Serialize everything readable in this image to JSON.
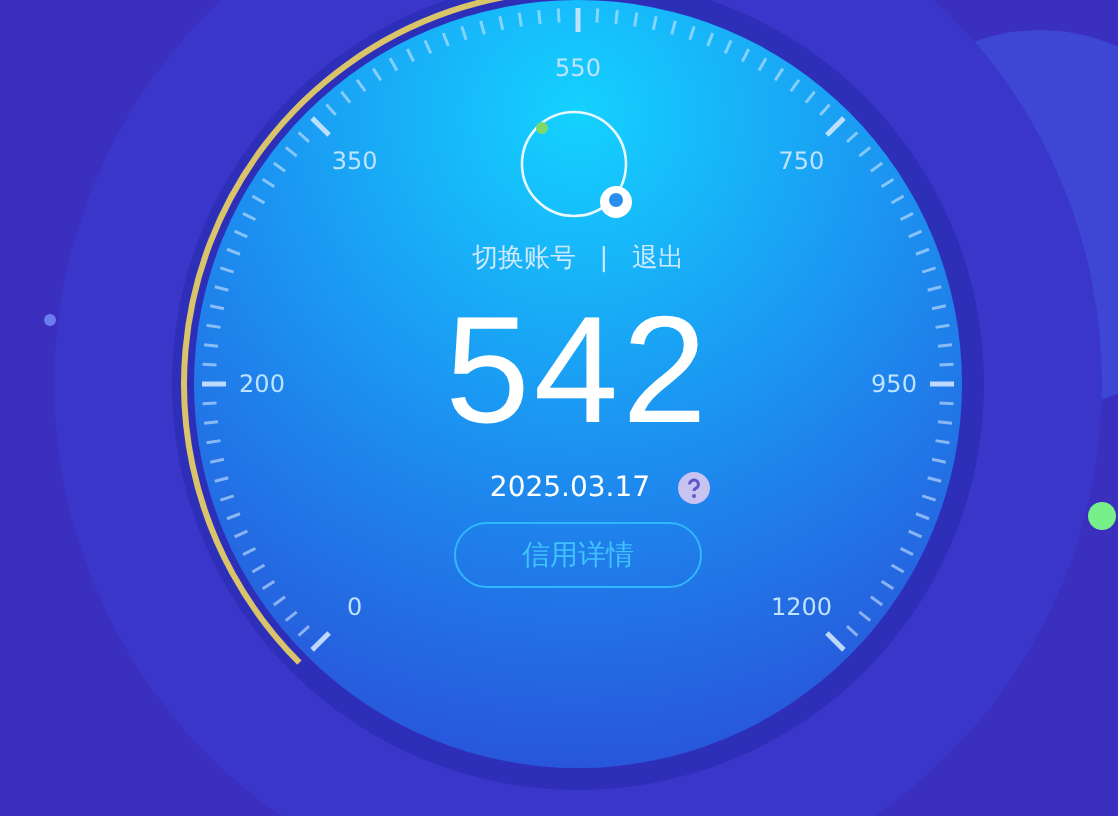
{
  "gauge": {
    "scale_labels": [
      "0",
      "200",
      "350",
      "550",
      "750",
      "950",
      "1200"
    ],
    "level": 0.49
  },
  "account_links": [
    "切换账号",
    "退出"
  ],
  "separator": "|",
  "score": "542",
  "date": "2025.03.17",
  "details_button": "信用详情"
}
